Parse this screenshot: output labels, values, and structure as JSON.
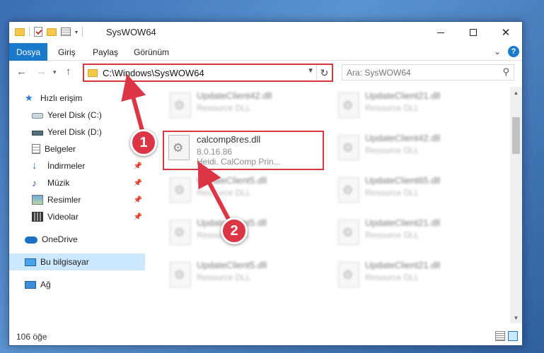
{
  "window": {
    "title": "SysWOW64",
    "controls": {
      "minimize": "",
      "maximize": "",
      "close": "✕"
    }
  },
  "ribbon": {
    "tabs": [
      "Dosya",
      "Giriş",
      "Paylaş",
      "Görünüm"
    ],
    "help": "?"
  },
  "navbar": {
    "path": "C:\\Windows\\SysWOW64",
    "search_placeholder": "Ara: SysWOW64"
  },
  "sidebar": {
    "items": [
      {
        "label": "Hızlı erişim",
        "icon": "star-icon"
      },
      {
        "label": "Yerel Disk (C:)",
        "icon": "drive-icon"
      },
      {
        "label": "Yerel Disk (D:)",
        "icon": "drive-icon"
      },
      {
        "label": "Belgeler",
        "icon": "document-icon"
      },
      {
        "label": "İndirmeler",
        "icon": "download-icon"
      },
      {
        "label": "Müzik",
        "icon": "music-icon"
      },
      {
        "label": "Resimler",
        "icon": "pictures-icon"
      },
      {
        "label": "Videolar",
        "icon": "video-icon"
      },
      {
        "label": "OneDrive",
        "icon": "cloud-icon"
      },
      {
        "label": "Bu bilgisayar",
        "icon": "computer-icon",
        "selected": true
      },
      {
        "label": "Ağ",
        "icon": "network-icon"
      }
    ]
  },
  "files": {
    "focused": {
      "name": "calcomp8res.dll",
      "version": "8.0.16.86",
      "company": "Heidi. CalComp Prin..."
    },
    "blurred": [
      {
        "name": "UpdateClient42.dll",
        "desc": "Resource DLL"
      },
      {
        "name": "UpdateClient21.dll",
        "desc": "Resource DLL"
      },
      {
        "name": "UpdateClient42.dll",
        "desc": "Resource DLL"
      },
      {
        "name": "UpdateClient5.dll",
        "desc": "Resource DLL"
      },
      {
        "name": "UpdateClient65.dll",
        "desc": "Resource DLL"
      },
      {
        "name": "UpdateClient5.dll",
        "desc": "Resource DLL"
      },
      {
        "name": "UpdateClient21.dll",
        "desc": "Resource DLL"
      },
      {
        "name": "UpdateClient5.dll",
        "desc": "Resource DLL"
      },
      {
        "name": "UpdateClient21.dll",
        "desc": "Resource DLL"
      }
    ]
  },
  "status": {
    "item_count": "106 öğe"
  },
  "annotations": {
    "step1": "1",
    "step2": "2",
    "color": "#dc3545"
  }
}
